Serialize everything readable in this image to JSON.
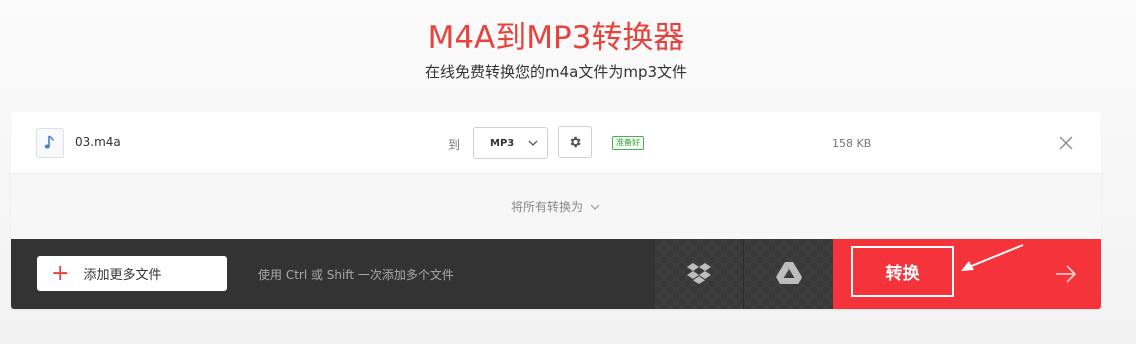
{
  "header": {
    "title": "M4A到MP3转换器",
    "subtitle": "在线免费转换您的m4a文件为mp3文件"
  },
  "file": {
    "icon": "music-note-icon",
    "name": "03.m4a",
    "to_label": "到",
    "format": "MP3",
    "status": "准备好",
    "size": "158 KB"
  },
  "convert_all": {
    "label": "将所有转换为"
  },
  "bottom": {
    "add_files_label": "添加更多文件",
    "hint": "使用 Ctrl 或 Shift 一次添加多个文件",
    "convert_label": "转换",
    "cloud_icons": [
      "dropbox-icon",
      "google-drive-icon"
    ]
  },
  "colors": {
    "brand_red": "#e8423c",
    "convert_bg": "#f5333a",
    "bar_bg": "#333333",
    "ready_green": "#4caf50"
  }
}
